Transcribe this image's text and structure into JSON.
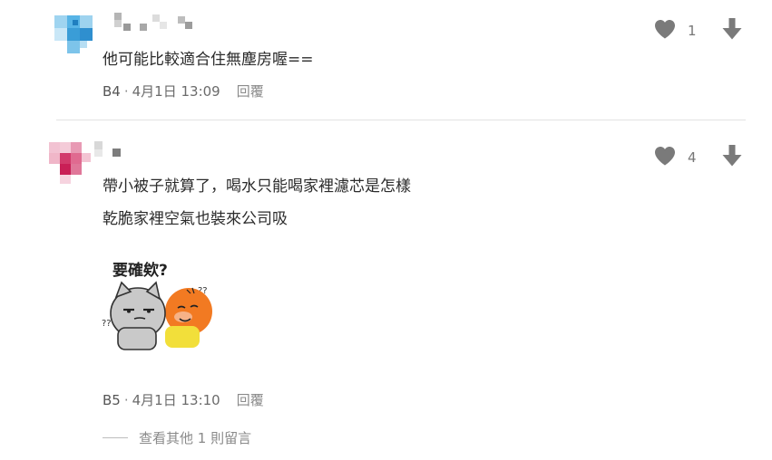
{
  "comments": [
    {
      "text_lines": [
        "他可能比較適合住無塵房喔=="
      ],
      "floor": "B4",
      "separator": "·",
      "timestamp": "4月1日 13:09",
      "reply_label": "回覆",
      "like_count": "1",
      "avatar_color": "#4aa6dc"
    },
    {
      "text_lines": [
        "帶小被子就算了，喝水只能喝家裡濾芯是怎樣",
        "乾脆家裡空氣也裝來公司吸"
      ],
      "floor": "B5",
      "separator": "·",
      "timestamp": "4月1日 13:10",
      "reply_label": "回覆",
      "like_count": "4",
      "avatar_color": "#d23a6b",
      "sticker": {
        "caption": "要確欸?",
        "marks": [
          "??",
          "??"
        ]
      }
    }
  ],
  "more_replies": {
    "label": "查看其他 1 則留言"
  },
  "icons": {
    "like": "heart-icon",
    "dislike": "arrow-down-icon"
  },
  "colors": {
    "icon": "#7a7a7a",
    "meta_text": "#6b6b6b",
    "divider": "#e3e3e3"
  }
}
